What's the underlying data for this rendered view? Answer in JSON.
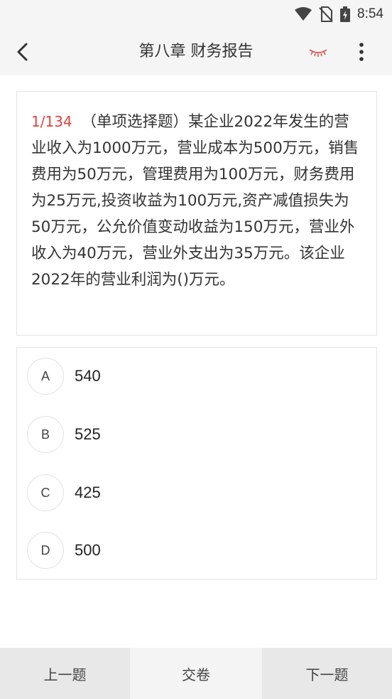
{
  "status_bar": {
    "time": "8:54",
    "icons": [
      "wifi-icon",
      "no-sim-icon",
      "battery-charging-icon"
    ]
  },
  "nav": {
    "title": "第八章 财务报告",
    "back_icon": "chevron-left-icon",
    "eye_icon": "closed-eye-icon",
    "more_icon": "more-vertical-icon",
    "accent_color": "#e0443e"
  },
  "question": {
    "number": "1/134",
    "text": "（单项选择题）某企业2022年发生的营业收入为1000万元，营业成本为500万元，销售费用为50万元，管理费用为100万元，财务费用为25万元,投资收益为100万元,资产减值损失为50万元，公允价值变动收益为150万元，营业外收入为40万元，营业外支出为35万元。该企业2022年的营业利润为()万元。"
  },
  "options": [
    {
      "letter": "A",
      "text": "540"
    },
    {
      "letter": "B",
      "text": "525"
    },
    {
      "letter": "C",
      "text": "425"
    },
    {
      "letter": "D",
      "text": "500"
    }
  ],
  "bottom": {
    "prev_label": "上一题",
    "submit_label": "交卷",
    "next_label": "下一题"
  }
}
